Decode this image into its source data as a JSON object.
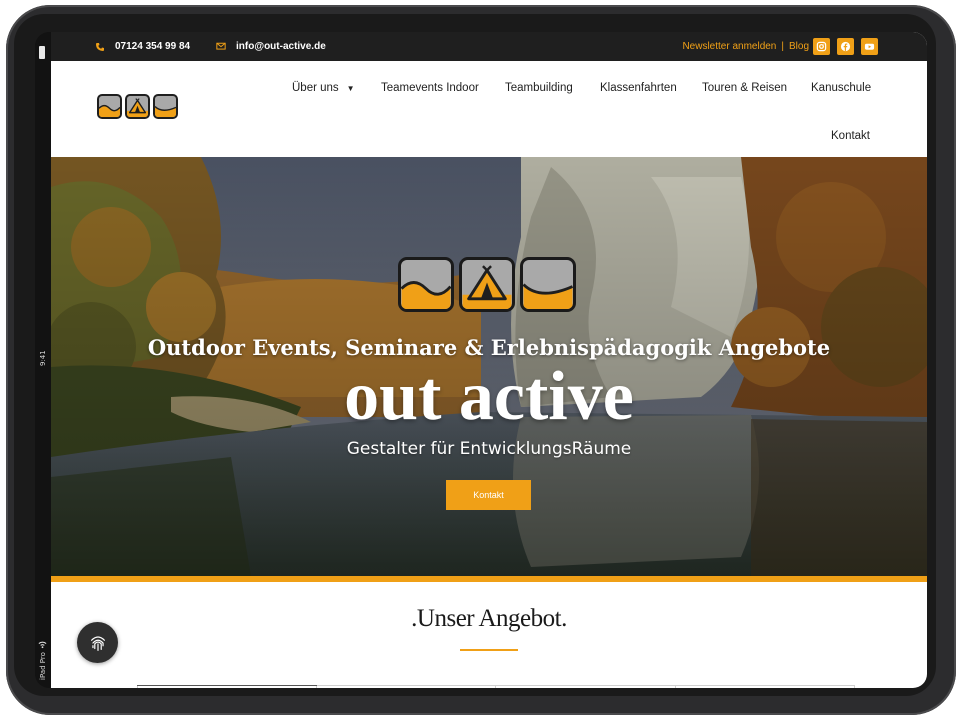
{
  "device": {
    "statusbar_time": "9:41",
    "statusbar_model": "iPad Pro"
  },
  "topbar": {
    "phone": "07124 354 99 84",
    "email": "info@out-active.de",
    "newsletter": "Newsletter anmelden",
    "separator": "|",
    "blog": "Blog",
    "social_icons": [
      "instagram-icon",
      "facebook-icon",
      "youtube-icon"
    ]
  },
  "nav": {
    "items": [
      {
        "label": "Über uns"
      },
      {
        "label": "Teamevents Indoor"
      },
      {
        "label": "Teambuilding"
      },
      {
        "label": "Klassenfahrten"
      },
      {
        "label": "Touren & Reisen"
      },
      {
        "label": "Kanuschule"
      },
      {
        "label": "Kontakt"
      }
    ]
  },
  "hero": {
    "tagline": "Outdoor Events, Seminare & Erlebnispädagogik Angebote",
    "title": "out active",
    "subtitle": "Gestalter für EntwicklungsRäume",
    "button": "Kontakt"
  },
  "offer": {
    "title": ".Unser Angebot."
  },
  "colors": {
    "accent": "#f0a017",
    "topbar_bg": "#1f1f1f",
    "text_dark": "#222222"
  }
}
